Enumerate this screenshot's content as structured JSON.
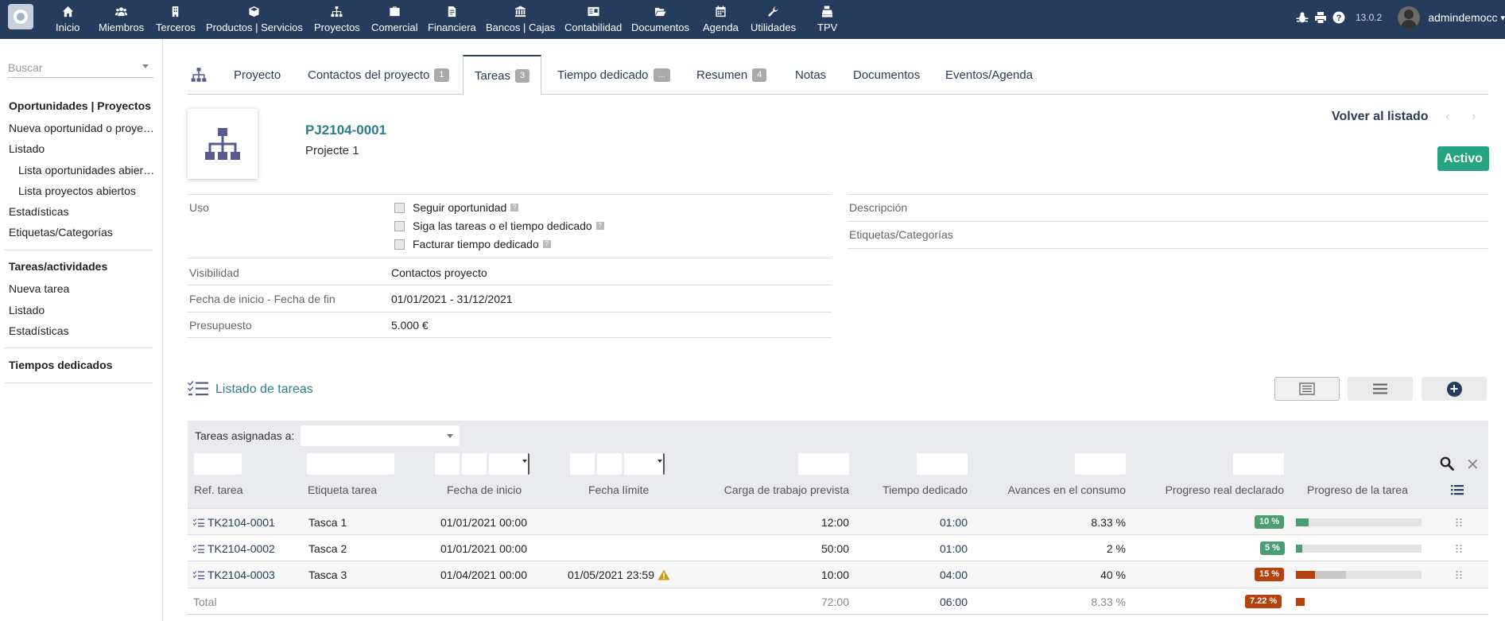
{
  "topbar": {
    "menu": [
      {
        "label": "Inicio",
        "icon": "home-icon"
      },
      {
        "label": "Miembros",
        "icon": "users-icon"
      },
      {
        "label": "Terceros",
        "icon": "building-icon"
      },
      {
        "label": "Productos | Servicios",
        "icon": "cube-icon"
      },
      {
        "label": "Proyectos",
        "icon": "sitemap-icon"
      },
      {
        "label": "Comercial",
        "icon": "briefcase-icon"
      },
      {
        "label": "Financiera",
        "icon": "file-invoice-icon"
      },
      {
        "label": "Bancos | Cajas",
        "icon": "bank-icon"
      },
      {
        "label": "Contabilidad",
        "icon": "ledger-icon"
      },
      {
        "label": "Documentos",
        "icon": "folder-open-icon"
      },
      {
        "label": "Agenda",
        "icon": "calendar-icon"
      },
      {
        "label": "Utilidades",
        "icon": "wrench-icon"
      },
      {
        "label": "TPV",
        "icon": "cash-register-icon"
      }
    ],
    "version": "13.0.2",
    "username": "admindemocc"
  },
  "sidebar": {
    "search_placeholder": "Buscar",
    "sections": [
      {
        "title": "Oportunidades | Proyectos",
        "items": [
          "Nueva oportunidad o proyecto",
          "Listado"
        ],
        "subitems": [
          "Lista oportunidades abiertas",
          "Lista proyectos abiertos"
        ],
        "after": [
          "Estadísticas",
          "Etiquetas/Categorías"
        ]
      },
      {
        "title": "Tareas/actividades",
        "items": [
          "Nueva tarea",
          "Listado",
          "Estadísticas"
        ]
      },
      {
        "title": "Tiempos dedicados"
      }
    ]
  },
  "tabs": [
    {
      "label": "Proyecto"
    },
    {
      "label": "Contactos del proyecto",
      "badge": "1"
    },
    {
      "label": "Tareas",
      "badge": "3",
      "active": true
    },
    {
      "label": "Tiempo dedicado",
      "badge": "..."
    },
    {
      "label": "Resumen",
      "badge": "4"
    },
    {
      "label": "Notas"
    },
    {
      "label": "Documentos"
    },
    {
      "label": "Eventos/Agenda"
    }
  ],
  "project": {
    "ref": "PJ2104-0001",
    "name": "Projecte 1",
    "back_label": "Volver al listado",
    "prev_arrow": "‹",
    "next_arrow": "›",
    "status": "Activo",
    "status_color": "#25a580"
  },
  "fields": {
    "uso_label": "Uso",
    "uso_options": [
      "Seguir oportunidad",
      "Siga las tareas o el tiempo dedicado",
      "Facturar tiempo dedicado"
    ],
    "help_glyph": "?",
    "visibilidad_label": "Visibilidad",
    "visibilidad_value": "Contactos proyecto",
    "fechas_label": "Fecha de inicio - Fecha de fin",
    "fechas_value": "01/01/2021 - 31/12/2021",
    "presupuesto_label": "Presupuesto",
    "presupuesto_value": "5.000 €",
    "descripcion_label": "Descripción",
    "etiquetas_label": "Etiquetas/Categorías"
  },
  "tasks": {
    "title": "Listado de tareas",
    "add_glyph": "+",
    "assigned_label": "Tareas asignadas a:",
    "clear_glyph": "✕",
    "columns": [
      "Ref. tarea",
      "Etiqueta tarea",
      "Fecha de inicio",
      "Fecha límite",
      "Carga de trabajo prevista",
      "Tiempo dedicado",
      "Avances en el consumo",
      "Progreso real declarado",
      "Progreso de la tarea"
    ],
    "rows": [
      {
        "ref": "TK2104-0001",
        "label": "Tasca 1",
        "start": "01/01/2021 00:00",
        "end": "",
        "planned": "12:00",
        "spent": "01:00",
        "consumption": "8.33 %",
        "declared": "10 %",
        "declared_value": 10,
        "consumption_value": 8.33,
        "badge_color": "#4a9e72",
        "warning": false
      },
      {
        "ref": "TK2104-0002",
        "label": "Tasca 2",
        "start": "01/01/2021 00:00",
        "end": "",
        "planned": "50:00",
        "spent": "01:00",
        "consumption": "2 %",
        "declared": "5 %",
        "declared_value": 5,
        "consumption_value": 2,
        "badge_color": "#4a9e72",
        "warning": false
      },
      {
        "ref": "TK2104-0003",
        "label": "Tasca 3",
        "start": "01/04/2021 00:00",
        "end": "01/05/2021 23:59",
        "planned": "10:00",
        "spent": "04:00",
        "consumption": "40 %",
        "declared": "15 %",
        "declared_value": 15,
        "consumption_value": 40,
        "badge_color": "#b3420f",
        "warning": true
      }
    ],
    "total": {
      "label": "Total",
      "planned": "72:00",
      "spent": "06:00",
      "consumption": "8.33 %",
      "declared": "7.22 %",
      "declared_value": 7.22,
      "badge_color": "#b3420f"
    }
  }
}
